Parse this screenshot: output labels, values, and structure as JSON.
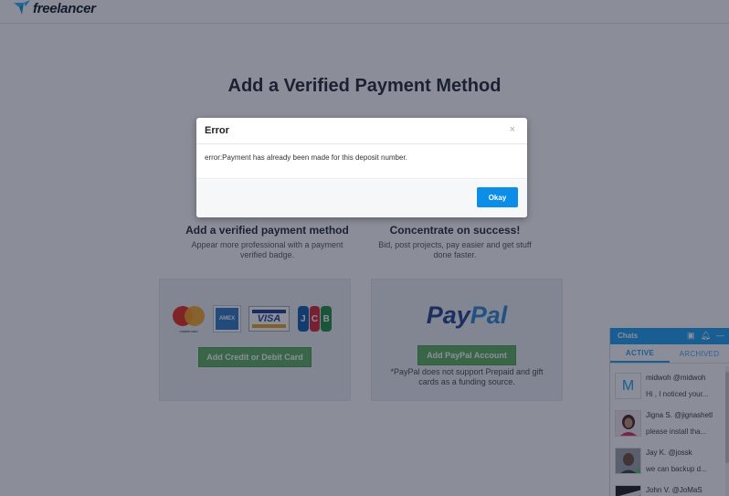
{
  "header": {
    "logo_text": "freelancer"
  },
  "page": {
    "title": "Add a Verified Payment Method",
    "features": [
      {
        "title": "Add a verified payment method",
        "desc": "Appear more professional with a payment verified badge."
      },
      {
        "title": "Concentrate on success!",
        "desc": "Bid, post projects, pay easier and get stuff done faster."
      }
    ],
    "cards": {
      "credit": {
        "button_label": "Add Credit or Debit Card",
        "mastercard_label": "mastercard",
        "amex_label": "AMEX",
        "visa_label": "VISA",
        "jcb_letters": [
          "J",
          "C",
          "B"
        ]
      },
      "paypal": {
        "logo_pay": "Pay",
        "logo_pal": "Pal",
        "button_label": "Add PayPal Account",
        "note": "*PayPal does not support Prepaid and gift cards as a funding source."
      }
    }
  },
  "modal": {
    "title": "Error",
    "close_glyph": "×",
    "message": "error:Payment has already been made for this deposit number.",
    "okay_label": "Okay"
  },
  "chat": {
    "title": "Chats",
    "icons": [
      "compose-icon",
      "bell-icon",
      "minimize-icon"
    ],
    "tabs": {
      "active": "ACTIVE",
      "archived": "ARCHIVED"
    },
    "items": [
      {
        "name": "midwoh @midwoh",
        "message": "Hi , I noticed your...",
        "avatar_letter": "M"
      },
      {
        "name": "Jigna S. @jignashetl",
        "message": "please install tha..."
      },
      {
        "name": "Jay K. @jossk",
        "message": "we can backup d..."
      },
      {
        "name": "John V. @JoMaS",
        "message": ""
      }
    ]
  },
  "colors": {
    "accent": "#1a9ff0",
    "okay_button": "#0b8de8",
    "green_button": "#5dae5d",
    "overlay": "rgba(24,30,52,0.5)"
  }
}
